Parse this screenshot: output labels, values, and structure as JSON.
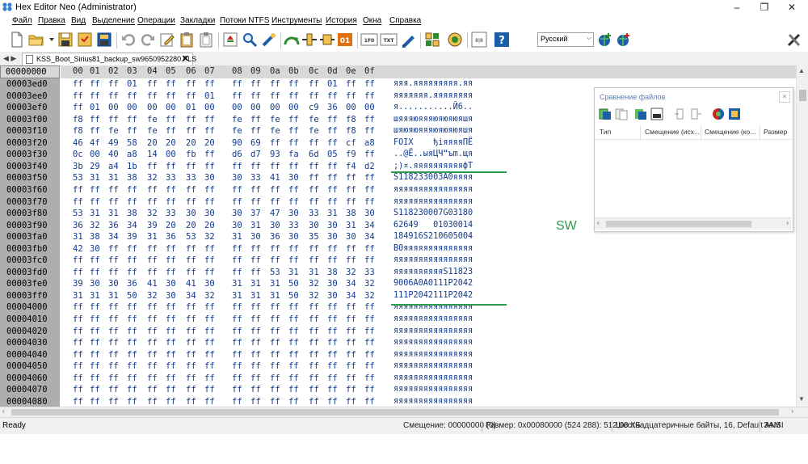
{
  "window": {
    "title": "Hex Editor Neo (Administrator)",
    "controls": [
      "–",
      "❐",
      "✕"
    ]
  },
  "menu": [
    "Файл",
    "Правка",
    "Вид",
    "Выделение",
    "Операции",
    "Закладки",
    "Потоки NTFS",
    "Инструменты",
    "История",
    "Окна",
    "Справка"
  ],
  "toolbar": {
    "language": "Русский",
    "icons": [
      "new-file-icon",
      "open-folder-icon",
      "save-icon",
      "save-all-icon",
      "save-as-icon",
      "undo-icon",
      "redo-icon",
      "edit-icon",
      "clipboard-icon",
      "clipboard-copy-icon",
      "find-icon",
      "find-replace-icon",
      "tools-icon",
      "bookmark-icon",
      "split-icon",
      "bit-icon",
      "hex-mode-icon",
      "text-mode-icon",
      "pen-icon",
      "grid-icon",
      "help-circle-icon",
      "columns-icon",
      "help-icon",
      "globe-add-icon",
      "globe-icon",
      "settings-tools-icon"
    ],
    "bit_label": "01",
    "hex_mode_label": "1F0",
    "text_mode_label": "TXT",
    "columns_label": "8|8",
    "help_label": "?"
  },
  "tab": {
    "nav": "◀ ▶",
    "title": "KSS_Boot_Sirius81_backup_sw9650952280.FLS",
    "close": "✕"
  },
  "hex": {
    "offset_header": "00000000",
    "column_headers": [
      "00",
      "01",
      "02",
      "03",
      "04",
      "05",
      "06",
      "07",
      "08",
      "09",
      "0a",
      "0b",
      "0c",
      "0d",
      "0e",
      "0f"
    ],
    "rows": [
      {
        "offset": "00003ed0",
        "bytes": [
          "ff",
          "ff",
          "ff",
          "01",
          "ff",
          "ff",
          "ff",
          "ff",
          "ff",
          "ff",
          "ff",
          "ff",
          "ff",
          "01",
          "ff",
          "ff"
        ],
        "ascii": "яяя.яяяяяяяяя.яя"
      },
      {
        "offset": "00003ee0",
        "bytes": [
          "ff",
          "ff",
          "ff",
          "ff",
          "ff",
          "ff",
          "ff",
          "01",
          "ff",
          "ff",
          "ff",
          "ff",
          "ff",
          "ff",
          "ff",
          "ff"
        ],
        "ascii": "яяяяяяя.яяяяяяяя"
      },
      {
        "offset": "00003ef0",
        "bytes": [
          "ff",
          "01",
          "00",
          "00",
          "00",
          "00",
          "01",
          "00",
          "00",
          "00",
          "00",
          "00",
          "c9",
          "36",
          "00",
          "00"
        ],
        "ascii": "я...........Й6.."
      },
      {
        "offset": "00003f00",
        "bytes": [
          "f8",
          "ff",
          "ff",
          "ff",
          "fe",
          "ff",
          "ff",
          "ff",
          "fe",
          "ff",
          "fe",
          "ff",
          "fe",
          "ff",
          "f8",
          "ff"
        ],
        "ascii": "шяяяюяяяюяюяюяшя"
      },
      {
        "offset": "00003f10",
        "bytes": [
          "f8",
          "ff",
          "fe",
          "ff",
          "fe",
          "ff",
          "ff",
          "ff",
          "fe",
          "ff",
          "fe",
          "ff",
          "fe",
          "ff",
          "f8",
          "ff"
        ],
        "ascii": "шяюяюяяяюяюяюяшя"
      },
      {
        "offset": "00003f20",
        "bytes": [
          "46",
          "4f",
          "49",
          "58",
          "20",
          "20",
          "20",
          "20",
          "90",
          "69",
          "ff",
          "ff",
          "ff",
          "ff",
          "cf",
          "a8"
        ],
        "ascii": "FOIX    ђiяяяяПЁ"
      },
      {
        "offset": "00003f30",
        "bytes": [
          "0c",
          "00",
          "40",
          "a8",
          "14",
          "00",
          "fb",
          "ff",
          "d6",
          "d7",
          "93",
          "fa",
          "6d",
          "05",
          "f9",
          "ff"
        ],
        "ascii": "..@Ё..ыяЦЧ“ъm.щя"
      },
      {
        "offset": "00003f40",
        "bytes": [
          "3b",
          "29",
          "a4",
          "1b",
          "ff",
          "ff",
          "ff",
          "ff",
          "ff",
          "ff",
          "ff",
          "ff",
          "ff",
          "ff",
          "f4",
          "d2"
        ],
        "ascii": ";)¤.яяяяяяяяяяфТ"
      },
      {
        "offset": "00003f50",
        "bytes": [
          "53",
          "31",
          "31",
          "38",
          "32",
          "33",
          "33",
          "30",
          "30",
          "33",
          "41",
          "30",
          "ff",
          "ff",
          "ff",
          "ff"
        ],
        "ascii": "S118233003A0яяяя"
      },
      {
        "offset": "00003f60",
        "bytes": [
          "ff",
          "ff",
          "ff",
          "ff",
          "ff",
          "ff",
          "ff",
          "ff",
          "ff",
          "ff",
          "ff",
          "ff",
          "ff",
          "ff",
          "ff",
          "ff"
        ],
        "ascii": "яяяяяяяяяяяяяяяя"
      },
      {
        "offset": "00003f70",
        "bytes": [
          "ff",
          "ff",
          "ff",
          "ff",
          "ff",
          "ff",
          "ff",
          "ff",
          "ff",
          "ff",
          "ff",
          "ff",
          "ff",
          "ff",
          "ff",
          "ff"
        ],
        "ascii": "яяяяяяяяяяяяяяяя"
      },
      {
        "offset": "00003f80",
        "bytes": [
          "53",
          "31",
          "31",
          "38",
          "32",
          "33",
          "30",
          "30",
          "30",
          "37",
          "47",
          "30",
          "33",
          "31",
          "38",
          "30"
        ],
        "ascii": "S118230007G03180"
      },
      {
        "offset": "00003f90",
        "bytes": [
          "36",
          "32",
          "36",
          "34",
          "39",
          "20",
          "20",
          "20",
          "30",
          "31",
          "30",
          "33",
          "30",
          "30",
          "31",
          "34"
        ],
        "ascii": "62649   01030014"
      },
      {
        "offset": "00003fa0",
        "bytes": [
          "31",
          "38",
          "34",
          "39",
          "31",
          "36",
          "53",
          "32",
          "31",
          "30",
          "36",
          "30",
          "35",
          "30",
          "30",
          "34"
        ],
        "ascii": "184916S210605004"
      },
      {
        "offset": "00003fb0",
        "bytes": [
          "42",
          "30",
          "ff",
          "ff",
          "ff",
          "ff",
          "ff",
          "ff",
          "ff",
          "ff",
          "ff",
          "ff",
          "ff",
          "ff",
          "ff",
          "ff"
        ],
        "ascii": "B0яяяяяяяяяяяяяя"
      },
      {
        "offset": "00003fc0",
        "bytes": [
          "ff",
          "ff",
          "ff",
          "ff",
          "ff",
          "ff",
          "ff",
          "ff",
          "ff",
          "ff",
          "ff",
          "ff",
          "ff",
          "ff",
          "ff",
          "ff"
        ],
        "ascii": "яяяяяяяяяяяяяяяя"
      },
      {
        "offset": "00003fd0",
        "bytes": [
          "ff",
          "ff",
          "ff",
          "ff",
          "ff",
          "ff",
          "ff",
          "ff",
          "ff",
          "ff",
          "53",
          "31",
          "31",
          "38",
          "32",
          "33"
        ],
        "ascii": "яяяяяяяяяяS11823"
      },
      {
        "offset": "00003fe0",
        "bytes": [
          "39",
          "30",
          "30",
          "36",
          "41",
          "30",
          "41",
          "30",
          "31",
          "31",
          "31",
          "50",
          "32",
          "30",
          "34",
          "32"
        ],
        "ascii": "9006A0A0111P2042"
      },
      {
        "offset": "00003ff0",
        "bytes": [
          "31",
          "31",
          "31",
          "50",
          "32",
          "30",
          "34",
          "32",
          "31",
          "31",
          "31",
          "50",
          "32",
          "30",
          "34",
          "32"
        ],
        "ascii": "111P2042111P2042"
      },
      {
        "offset": "00004000",
        "bytes": [
          "ff",
          "ff",
          "ff",
          "ff",
          "ff",
          "ff",
          "ff",
          "ff",
          "ff",
          "ff",
          "ff",
          "ff",
          "ff",
          "ff",
          "ff",
          "ff"
        ],
        "ascii": "яяяяяяяяяяяяяяяя"
      },
      {
        "offset": "00004010",
        "bytes": [
          "ff",
          "ff",
          "ff",
          "ff",
          "ff",
          "ff",
          "ff",
          "ff",
          "ff",
          "ff",
          "ff",
          "ff",
          "ff",
          "ff",
          "ff",
          "ff"
        ],
        "ascii": "яяяяяяяяяяяяяяяя"
      },
      {
        "offset": "00004020",
        "bytes": [
          "ff",
          "ff",
          "ff",
          "ff",
          "ff",
          "ff",
          "ff",
          "ff",
          "ff",
          "ff",
          "ff",
          "ff",
          "ff",
          "ff",
          "ff",
          "ff"
        ],
        "ascii": "яяяяяяяяяяяяяяяя"
      },
      {
        "offset": "00004030",
        "bytes": [
          "ff",
          "ff",
          "ff",
          "ff",
          "ff",
          "ff",
          "ff",
          "ff",
          "ff",
          "ff",
          "ff",
          "ff",
          "ff",
          "ff",
          "ff",
          "ff"
        ],
        "ascii": "яяяяяяяяяяяяяяяя"
      },
      {
        "offset": "00004040",
        "bytes": [
          "ff",
          "ff",
          "ff",
          "ff",
          "ff",
          "ff",
          "ff",
          "ff",
          "ff",
          "ff",
          "ff",
          "ff",
          "ff",
          "ff",
          "ff",
          "ff"
        ],
        "ascii": "яяяяяяяяяяяяяяяя"
      },
      {
        "offset": "00004050",
        "bytes": [
          "ff",
          "ff",
          "ff",
          "ff",
          "ff",
          "ff",
          "ff",
          "ff",
          "ff",
          "ff",
          "ff",
          "ff",
          "ff",
          "ff",
          "ff",
          "ff"
        ],
        "ascii": "яяяяяяяяяяяяяяяя"
      },
      {
        "offset": "00004060",
        "bytes": [
          "ff",
          "ff",
          "ff",
          "ff",
          "ff",
          "ff",
          "ff",
          "ff",
          "ff",
          "ff",
          "ff",
          "ff",
          "ff",
          "ff",
          "ff",
          "ff"
        ],
        "ascii": "яяяяяяяяяяяяяяяя"
      },
      {
        "offset": "00004070",
        "bytes": [
          "ff",
          "ff",
          "ff",
          "ff",
          "ff",
          "ff",
          "ff",
          "ff",
          "ff",
          "ff",
          "ff",
          "ff",
          "ff",
          "ff",
          "ff",
          "ff"
        ],
        "ascii": "яяяяяяяяяяяяяяяя"
      },
      {
        "offset": "00004080",
        "bytes": [
          "ff",
          "ff",
          "ff",
          "ff",
          "ff",
          "ff",
          "ff",
          "ff",
          "ff",
          "ff",
          "ff",
          "ff",
          "ff",
          "ff",
          "ff",
          "ff"
        ],
        "ascii": "яяяяяяяяяяяяяяяя"
      }
    ]
  },
  "annotation": {
    "label": "SW",
    "color": "#2e9b4f"
  },
  "compare_panel": {
    "title": "Сравнение файлов",
    "close": "✕",
    "columns": [
      "Тип",
      "Смещение (исх...",
      "Смещение (ко...",
      "Размер"
    ],
    "icons": [
      "compare-open-icon",
      "compare-files-icon",
      "compare-prev-icon",
      "compare-hex-icon",
      "compare-undo-icon",
      "compare-redo-icon",
      "compare-color-icon",
      "compare-settings-icon"
    ]
  },
  "status": {
    "ready": "Ready",
    "offset": "Смещение: 00000000 (0)",
    "size": "Размер: 0x00080000 (524 288): 512,00 КБ",
    "mode": "Шестнадцатеричные байты, 16, Default ANSI",
    "lock": "ЗАМ"
  }
}
